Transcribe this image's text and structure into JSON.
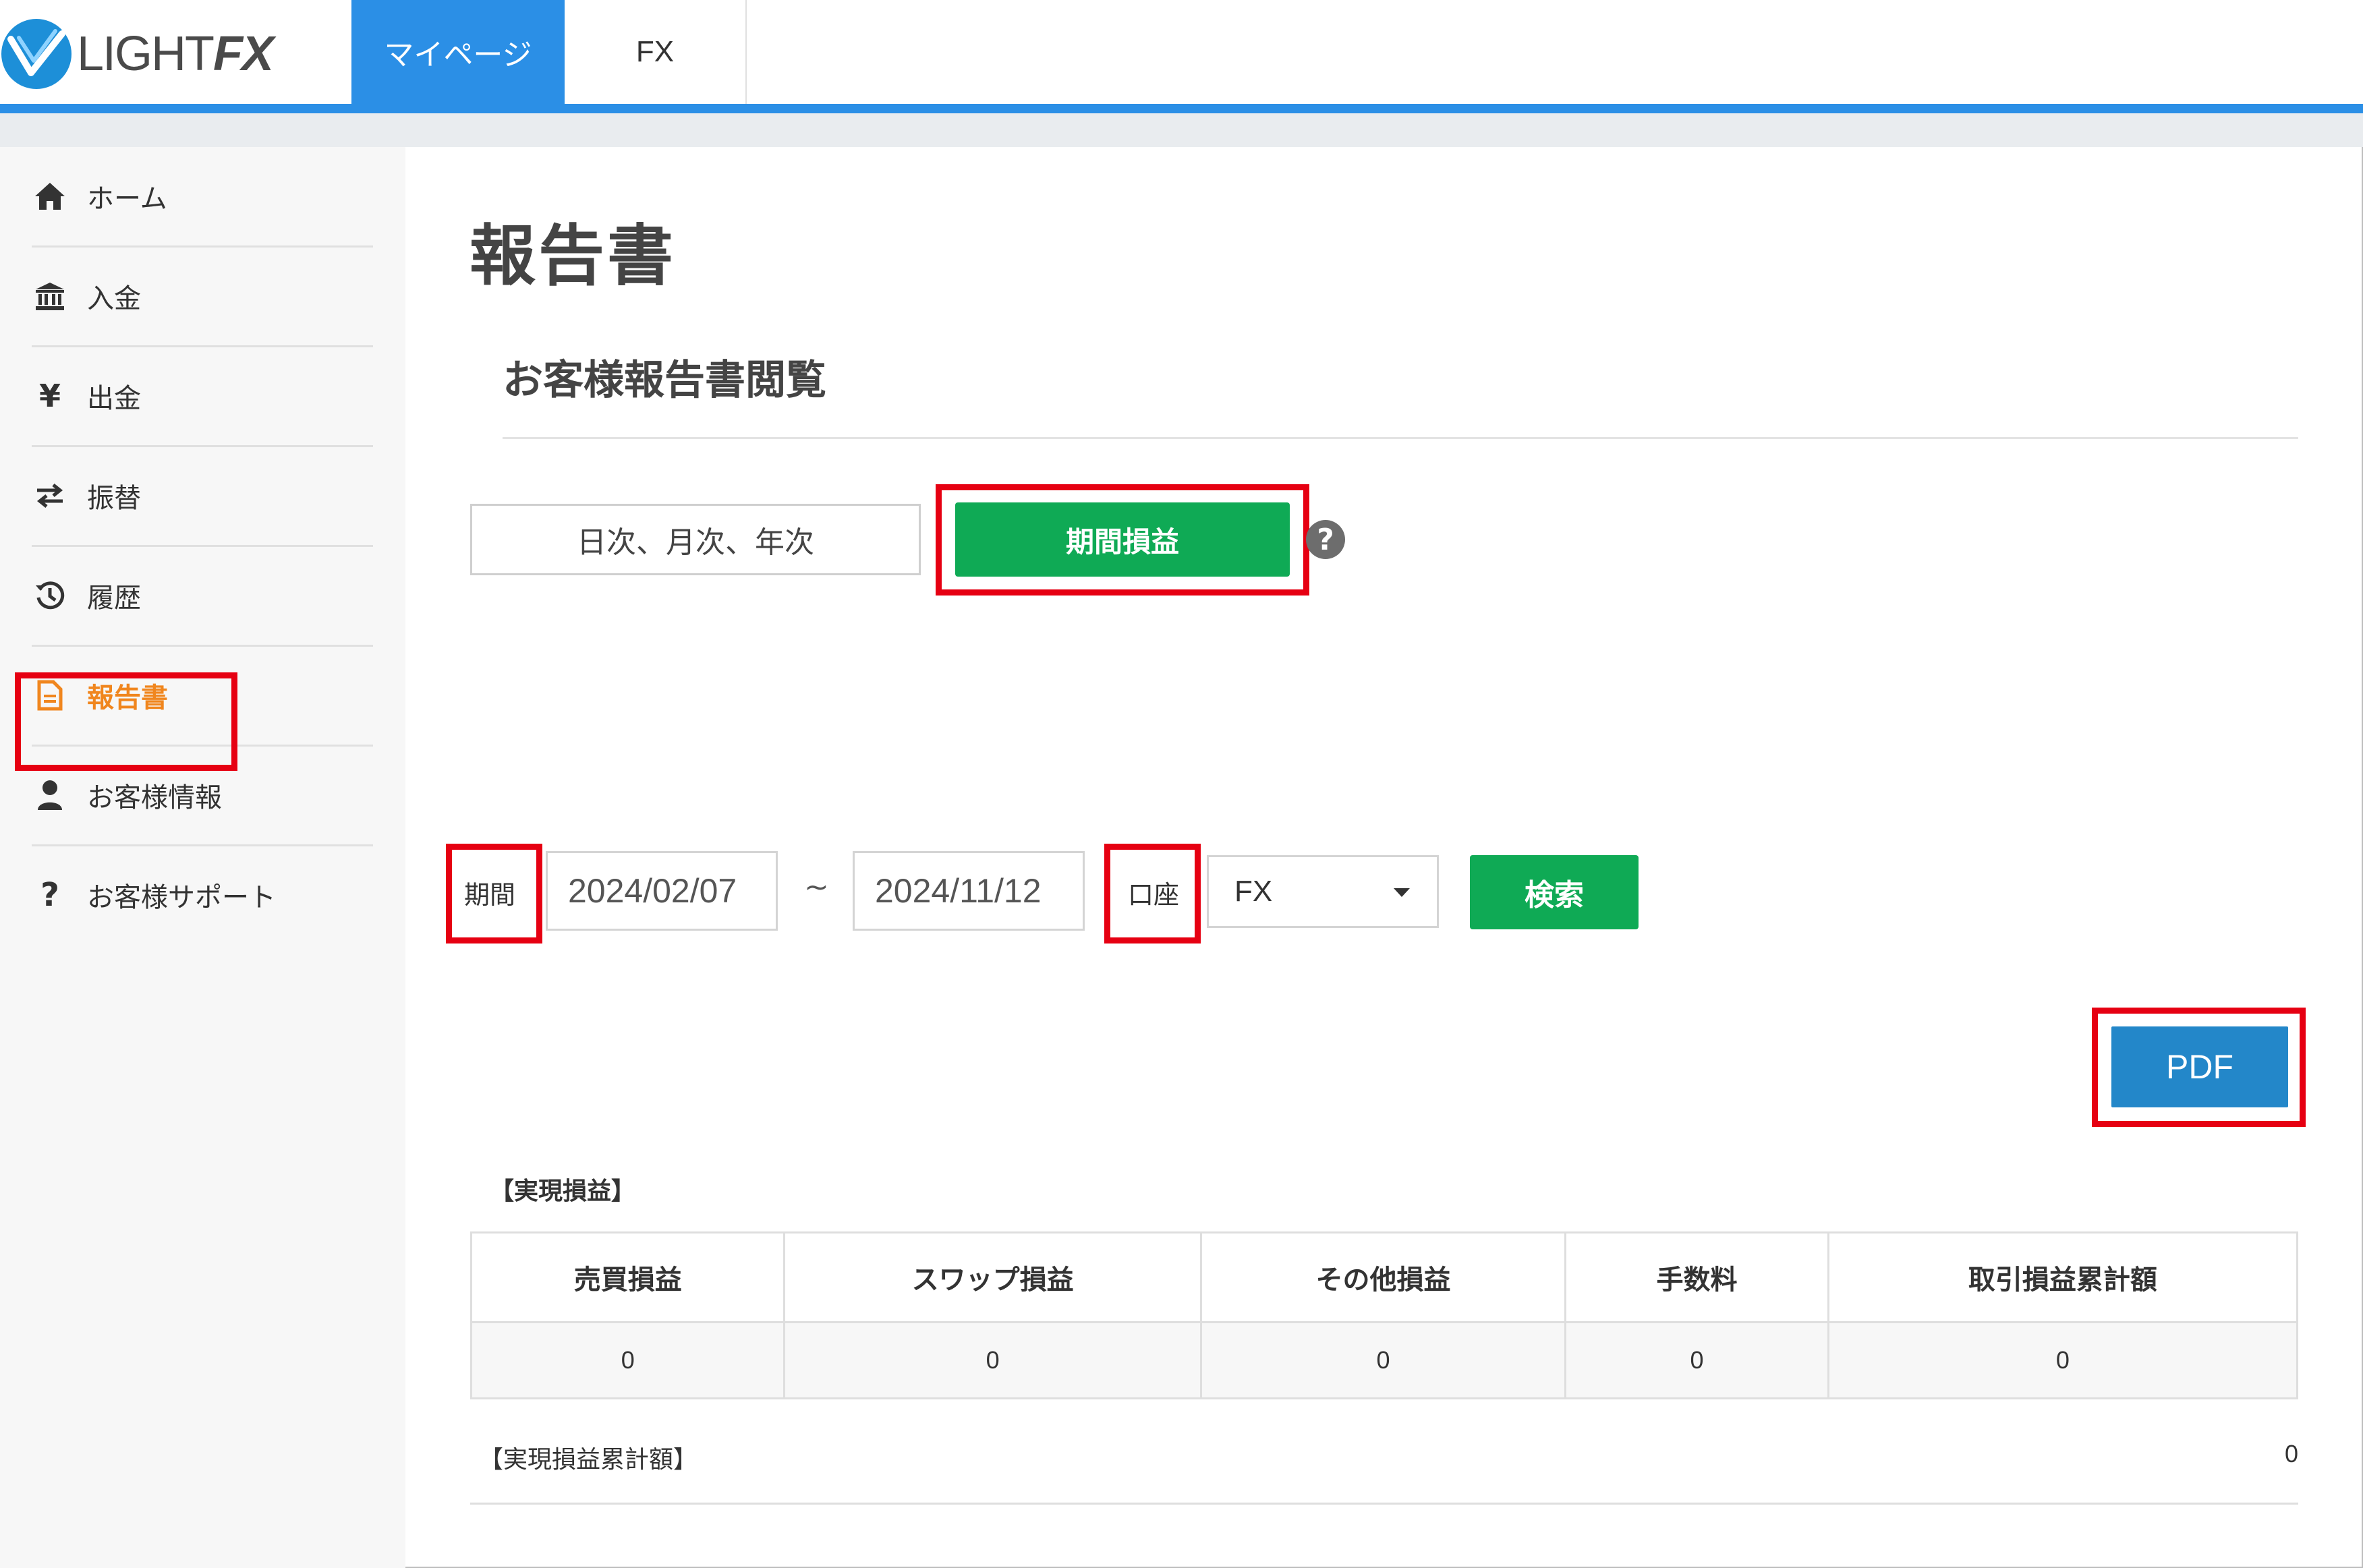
{
  "header": {
    "logo_text_light": "LIGHT",
    "logo_text_fx": "FX",
    "tabs": [
      {
        "label": "マイページ",
        "active": true
      },
      {
        "label": "FX",
        "active": false
      }
    ],
    "accent_color": "#2b8fe6"
  },
  "sidebar": {
    "items": [
      {
        "label": "ホーム",
        "icon": "home-icon"
      },
      {
        "label": "入金",
        "icon": "bank-icon"
      },
      {
        "label": "出金",
        "icon": "yen-icon"
      },
      {
        "label": "振替",
        "icon": "transfer-icon"
      },
      {
        "label": "履歴",
        "icon": "history-icon"
      },
      {
        "label": "報告書",
        "icon": "document-icon",
        "active": true
      },
      {
        "label": "お客様情報",
        "icon": "user-icon"
      },
      {
        "label": "お客様サポート",
        "icon": "question-icon"
      }
    ],
    "active_color": "#f0861e"
  },
  "main": {
    "page_title": "報告書",
    "section_title": "お客様報告書閲覧",
    "mode_buttons": {
      "daily_monthly_yearly": "日次、月次、年次",
      "period_pl": "期間損益"
    },
    "help_icon": "?",
    "filters": {
      "period_label": "期間",
      "date_from": "2024/02/07",
      "separator": "~",
      "date_to": "2024/11/12",
      "account_label": "口座",
      "account_selected": "FX",
      "search_label": "検索"
    },
    "pdf_label": "PDF",
    "realized_section_label": "【実現損益】",
    "table": {
      "headers": [
        "売買損益",
        "スワップ損益",
        "その他損益",
        "手数料",
        "取引損益累計額"
      ],
      "rows": [
        [
          "0",
          "0",
          "0",
          "0",
          "0"
        ]
      ]
    },
    "cumulative_label": "【実現損益累計額】",
    "cumulative_value": "0",
    "button_green": "#0faa55",
    "button_blue": "#2387c9",
    "highlight_red": "#e60012"
  }
}
